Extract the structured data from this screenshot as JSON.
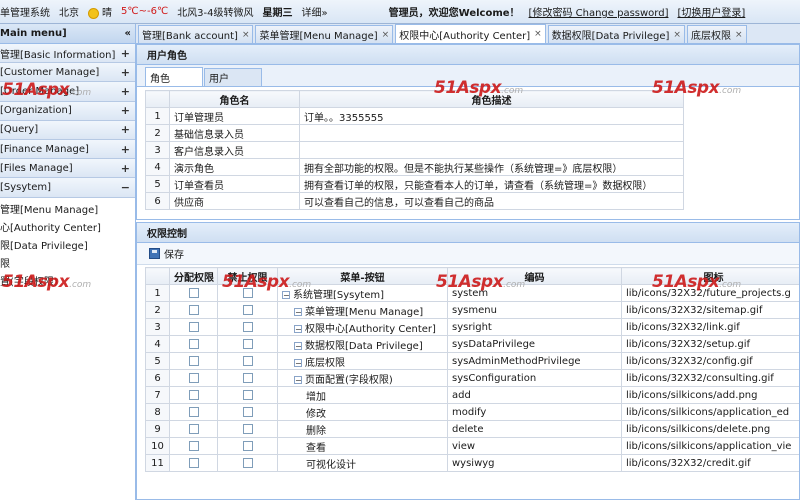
{
  "topbar": {
    "system_name": "单管理系统",
    "city": "北京",
    "weather": "晴",
    "temperature": "5℃~-6℃",
    "wind": "北风3-4级转微风",
    "weekday": "星期三",
    "detail_link": "详细»",
    "welcome": "管理员，欢迎您Welcome！",
    "change_password": "[修改密码 Change password]",
    "switch_user": "[切换用户登录]"
  },
  "sidebar": {
    "title": "Main menu]",
    "collapse_icon": "«",
    "sections": [
      {
        "label": "管理[Basic Information]",
        "sign": "+"
      },
      {
        "label": "[Customer Manage]",
        "sign": "+"
      },
      {
        "label": "[Order Manage]",
        "sign": "+"
      },
      {
        "label": "[Organization]",
        "sign": "+"
      },
      {
        "label": "[Query]",
        "sign": "+"
      },
      {
        "label": "[Finance Manage]",
        "sign": "+"
      },
      {
        "label": "[Files Manage]",
        "sign": "+"
      },
      {
        "label": "[Sysytem]",
        "sign": "−"
      }
    ],
    "sub_items": [
      "管理[Menu Manage]",
      "心[Authority Center]",
      "限[Data Privilege]",
      "限",
      "置(字段权限)"
    ]
  },
  "tabs": [
    {
      "label": "管理[Bank account]",
      "active": false
    },
    {
      "label": "菜单管理[Menu Manage]",
      "active": false
    },
    {
      "label": "权限中心[Authority Center]",
      "active": true
    },
    {
      "label": "数据权限[Data Privilege]",
      "active": false
    },
    {
      "label": "底层权限",
      "active": false
    }
  ],
  "role_panel": {
    "title": "用户角色",
    "subtabs": [
      "角色",
      "用户"
    ],
    "columns": [
      "",
      "角色名",
      "角色描述"
    ],
    "rows": [
      {
        "num": "1",
        "name": "订单管理员",
        "desc": "订单。。3355555"
      },
      {
        "num": "2",
        "name": "基础信息录入员",
        "desc": ""
      },
      {
        "num": "3",
        "name": "客户信息录入员",
        "desc": ""
      },
      {
        "num": "4",
        "name": "演示角色",
        "desc": "拥有全部功能的权限。但是不能执行某些操作（系统管理=》底层权限）"
      },
      {
        "num": "5",
        "name": "订单查看员",
        "desc": "拥有查看订单的权限，只能查看本人的订单，请查看（系统管理=》数据权限）"
      },
      {
        "num": "6",
        "name": "供应商",
        "desc": "可以查看自己的信息，可以查看自己的商品"
      }
    ]
  },
  "perm_panel": {
    "title": "权限控制",
    "save_label": "保存",
    "columns": [
      "",
      "分配权限",
      "禁止权限",
      "菜单-按钮",
      "编码",
      "图标"
    ],
    "rows": [
      {
        "num": "1",
        "tree": "⊟",
        "indent": 0,
        "name": "系统管理[Sysytem]",
        "code": "system",
        "icon": "lib/icons/32X32/future_projects.g"
      },
      {
        "num": "2",
        "tree": "⊟",
        "indent": 1,
        "name": "菜单管理[Menu Manage]",
        "code": "sysmenu",
        "icon": "lib/icons/32X32/sitemap.gif"
      },
      {
        "num": "3",
        "tree": "⊟",
        "indent": 1,
        "name": "权限中心[Authority Center]",
        "code": "sysright",
        "icon": "lib/icons/32X32/link.gif"
      },
      {
        "num": "4",
        "tree": "⊟",
        "indent": 1,
        "name": "数据权限[Data Privilege]",
        "code": "sysDataPrivilege",
        "icon": "lib/icons/32X32/setup.gif"
      },
      {
        "num": "5",
        "tree": "⊟",
        "indent": 1,
        "name": "底层权限",
        "code": "sysAdminMethodPrivilege",
        "icon": "lib/icons/32X32/config.gif"
      },
      {
        "num": "6",
        "tree": "⊟",
        "indent": 1,
        "name": "页面配置(字段权限)",
        "code": "sysConfiguration",
        "icon": "lib/icons/32X32/consulting.gif"
      },
      {
        "num": "7",
        "tree": "",
        "indent": 2,
        "name": "增加",
        "code": "add",
        "icon": "lib/icons/silkicons/add.png"
      },
      {
        "num": "8",
        "tree": "",
        "indent": 2,
        "name": "修改",
        "code": "modify",
        "icon": "lib/icons/silkicons/application_ed"
      },
      {
        "num": "9",
        "tree": "",
        "indent": 2,
        "name": "删除",
        "code": "delete",
        "icon": "lib/icons/silkicons/delete.png"
      },
      {
        "num": "10",
        "tree": "",
        "indent": 2,
        "name": "查看",
        "code": "view",
        "icon": "lib/icons/silkicons/application_vie"
      },
      {
        "num": "11",
        "tree": "",
        "indent": 2,
        "name": "可视化设计",
        "code": "wysiwyg",
        "icon": "lib/icons/32X32/credit.gif"
      }
    ]
  },
  "watermark": {
    "brand": "51Aspx",
    "domain": ".com"
  }
}
